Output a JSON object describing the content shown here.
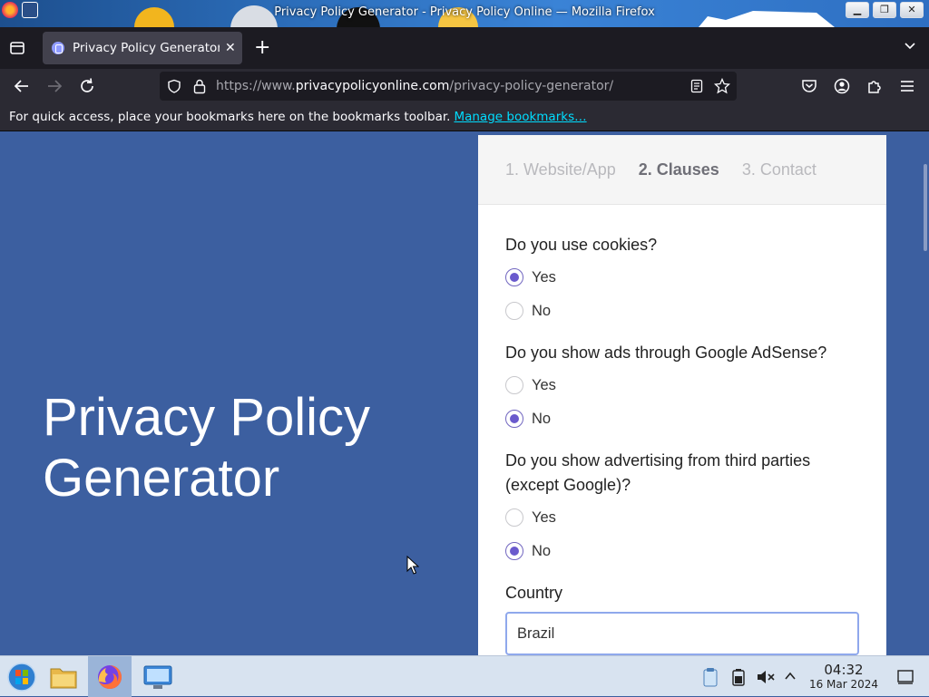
{
  "window": {
    "title": "Privacy Policy Generator - Privacy Policy Online — Mozilla Firefox",
    "buttons": [
      "minimize",
      "maximize",
      "close"
    ]
  },
  "tabs": [
    {
      "label": "Privacy Policy Generator",
      "active": true
    }
  ],
  "navbar": {
    "url_prefix": "https://www.",
    "url_domain": "privacypolicyonline.com",
    "url_path": "/privacy-policy-generator/"
  },
  "bookmarks": {
    "message": "For quick access, place your bookmarks here on the bookmarks toolbar.",
    "link": "Manage bookmarks…"
  },
  "page": {
    "hero_title": "Privacy Policy Generator",
    "steps": [
      "1. Website/App",
      "2. Clauses",
      "3. Contact"
    ],
    "active_step": 1,
    "questions": [
      {
        "text": "Do you use cookies?",
        "options": [
          "Yes",
          "No"
        ],
        "selected": "Yes"
      },
      {
        "text": "Do you show ads through Google AdSense?",
        "options": [
          "Yes",
          "No"
        ],
        "selected": "No"
      },
      {
        "text": "Do you show advertising from third parties (except Google)?",
        "options": [
          "Yes",
          "No"
        ],
        "selected": "No"
      }
    ],
    "country": {
      "label": "Country",
      "value": "Brazil"
    },
    "colors": {
      "background": "#3c5fa0",
      "accent": "#6a5acd"
    }
  },
  "taskbar": {
    "apps": [
      "start-menu",
      "file-manager",
      "firefox",
      "system-settings"
    ],
    "clock": {
      "time": "04:32",
      "date": "16 Mar 2024"
    }
  }
}
